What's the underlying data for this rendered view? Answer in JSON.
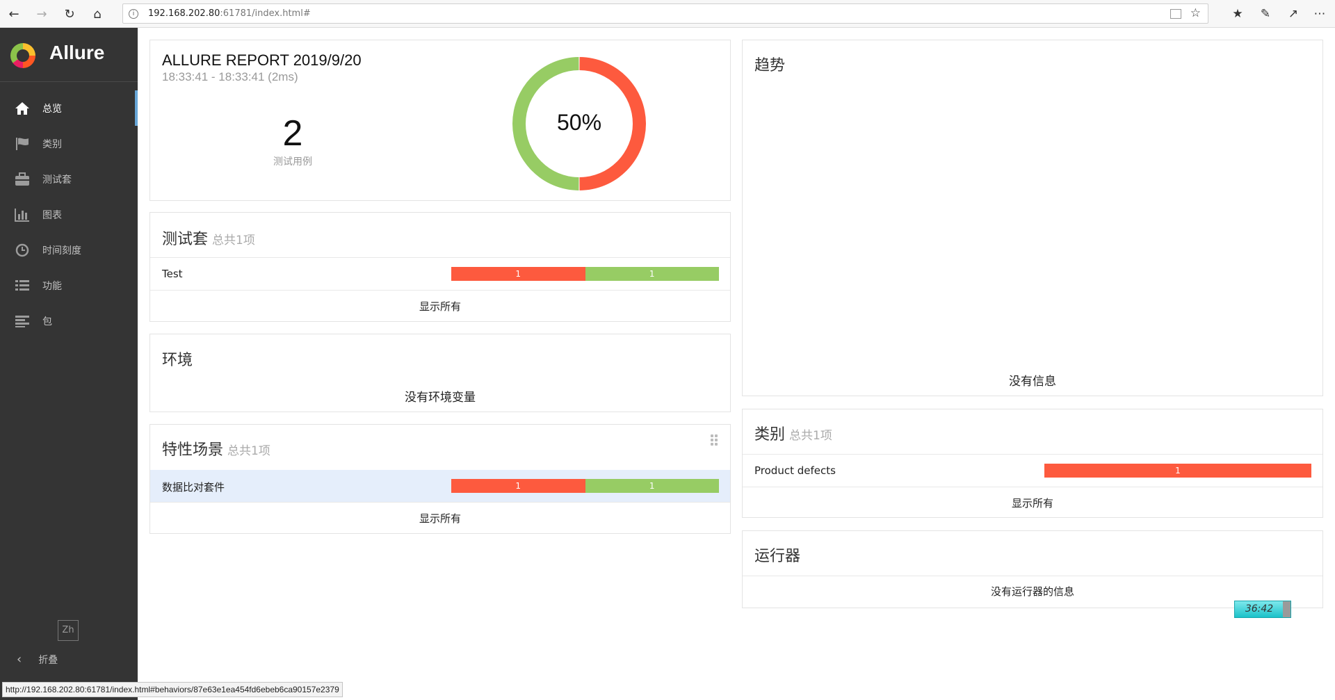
{
  "browser": {
    "url_host": "192.168.202.80",
    "url_rest": ":61781/index.html#",
    "status_url": "http://192.168.202.80:61781/index.html#behaviors/87e63e1ea454fd6ebeb6ca90157e2379"
  },
  "sidebar": {
    "brand": "Allure",
    "items": [
      {
        "label": "总览",
        "icon": "home-icon",
        "active": true
      },
      {
        "label": "类别",
        "icon": "flag-icon",
        "active": false
      },
      {
        "label": "测试套",
        "icon": "briefcase-icon",
        "active": false
      },
      {
        "label": "图表",
        "icon": "bar-chart-icon",
        "active": false
      },
      {
        "label": "时间刻度",
        "icon": "clock-icon",
        "active": false
      },
      {
        "label": "功能",
        "icon": "list-icon",
        "active": false
      },
      {
        "label": "包",
        "icon": "align-left-icon",
        "active": false
      }
    ],
    "lang": "Zh",
    "collapse_label": "折叠"
  },
  "summary": {
    "title": "ALLURE REPORT 2019/9/20",
    "time": "18:33:41 - 18:33:41 (2ms)",
    "count": "2",
    "count_label": "测试用例",
    "percent_label": "50%",
    "failed_fraction": 0.5,
    "passed_fraction": 0.5,
    "colors": {
      "failed": "#fd5a3e",
      "passed": "#97cc64"
    }
  },
  "suites": {
    "title": "测试套",
    "subtitle": "总共1项",
    "rows": [
      {
        "name": "Test",
        "failed": "1",
        "passed": "1"
      }
    ],
    "show_all": "显示所有"
  },
  "environment": {
    "title": "环境",
    "empty": "没有环境变量"
  },
  "features": {
    "title": "特性场景",
    "subtitle": "总共1项",
    "rows": [
      {
        "name": "数据比对套件",
        "failed": "1",
        "passed": "1"
      }
    ],
    "show_all": "显示所有"
  },
  "trend": {
    "title": "趋势",
    "empty": "没有信息"
  },
  "categories": {
    "title": "类别",
    "subtitle": "总共1项",
    "rows": [
      {
        "name": "Product defects",
        "failed": "1"
      }
    ],
    "show_all": "显示所有"
  },
  "executors": {
    "title": "运行器",
    "empty": "没有运行器的信息"
  },
  "timer": "36:42"
}
